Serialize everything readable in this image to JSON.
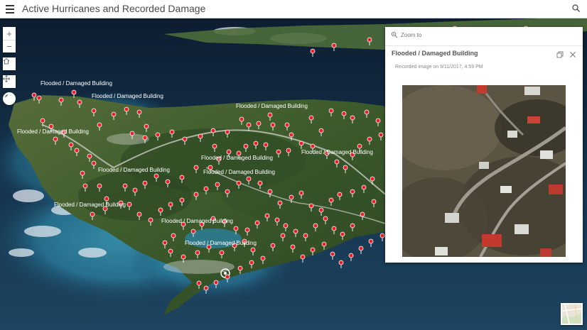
{
  "header": {
    "title": "Active Hurricanes and Recorded Damage",
    "menu_icon": "hamburger-menu-icon",
    "search_icon": "search-icon"
  },
  "map": {
    "controls": {
      "zoom_in": "+",
      "zoom_out": "−",
      "zoom_in_icon": "plus-icon",
      "zoom_out_icon": "minus-icon",
      "home_icon": "home-icon",
      "pan_icon": "pan-arrows-icon",
      "compass_icon": "compass-icon"
    },
    "damage_label": "Flooded / Damaged Building",
    "colors": {
      "marker": "#e8202a",
      "sea_deep": "#0e2236",
      "land": "#3e5a2c"
    }
  },
  "popup": {
    "zoom_label": "Zoom to",
    "title": "Flooded / Damaged Building",
    "subtitle": "Recorded image on 9/11/2017, 4:59 PM",
    "dock_icon": "dock-icon",
    "close_icon": "close-icon"
  },
  "basemap": {
    "icon": "basemap-toggle-icon"
  }
}
